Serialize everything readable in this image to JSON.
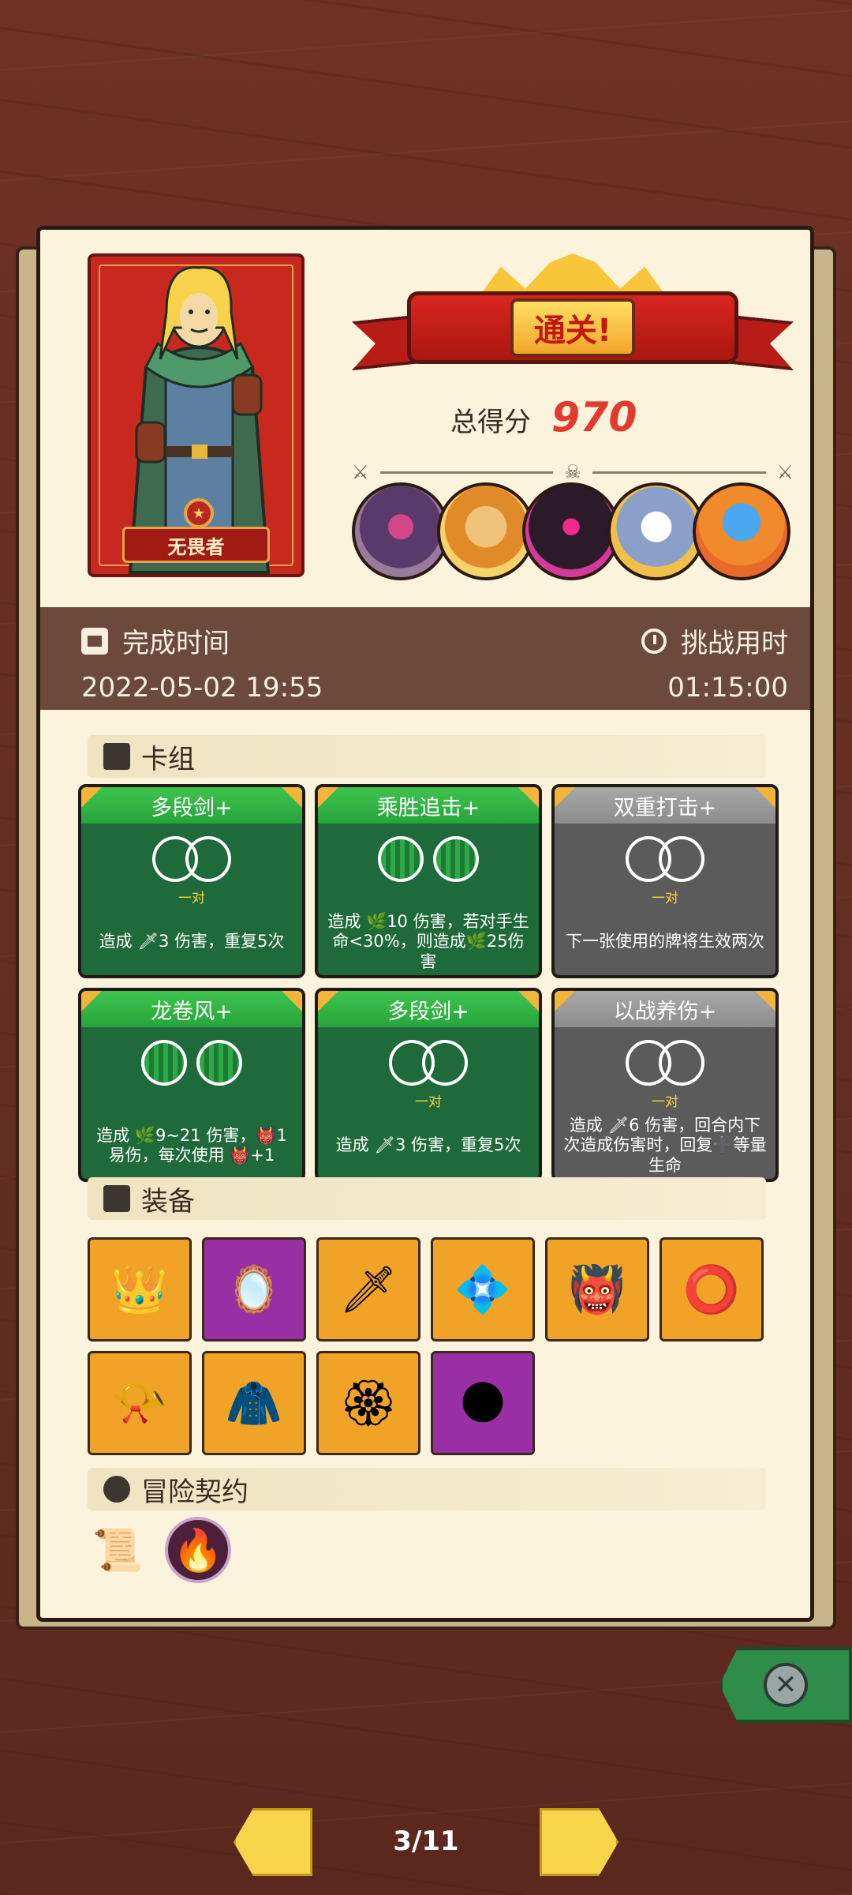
{
  "result": {
    "title": "通关!",
    "score_label": "总得分",
    "score_value": "970",
    "hero_name": "无畏者"
  },
  "info": {
    "completion_label": "完成时间",
    "completion_value": "2022-05-02 19:55",
    "duration_label": "挑战用时",
    "duration_value": "01:15:00"
  },
  "deck": {
    "title": "卡组",
    "cards": [
      {
        "name": "多段剑+",
        "style": "green",
        "orbs": "hollow",
        "pair": "一对",
        "desc": "造成 🗡3 伤害，重复5次"
      },
      {
        "name": "乘胜追击+",
        "style": "green",
        "orbs": "filled",
        "pair": "",
        "desc": "造成 🌿10 伤害，若对手生命<30%，则造成🌿25伤害"
      },
      {
        "name": "双重打击+",
        "style": "gray",
        "orbs": "hollow",
        "pair": "一对",
        "desc": "下一张使用的牌将生效两次"
      },
      {
        "name": "龙卷风+",
        "style": "green",
        "orbs": "filled",
        "pair": "",
        "desc": "造成 🌿9~21 伤害，👹1 易伤，每次使用 👹+1"
      },
      {
        "name": "多段剑+",
        "style": "green",
        "orbs": "hollow",
        "pair": "一对",
        "desc": "造成 🗡3 伤害，重复5次"
      },
      {
        "name": "以战养伤+",
        "style": "gray",
        "orbs": "hollow",
        "pair": "一对",
        "desc": "造成 🗡6 伤害，回合内下次造成伤害时，回复➕等量生命"
      }
    ]
  },
  "equipment": {
    "title": "装备",
    "items": [
      {
        "icon": "crown-icon",
        "glyph": "👑",
        "color": "orange"
      },
      {
        "icon": "mirror-icon",
        "glyph": "🪞",
        "color": "purple"
      },
      {
        "icon": "broken-blade-icon",
        "glyph": "🗡",
        "color": "orange"
      },
      {
        "icon": "blue-gem-shield-icon",
        "glyph": "💠",
        "color": "orange"
      },
      {
        "icon": "demon-skull-icon",
        "glyph": "👹",
        "color": "orange"
      },
      {
        "icon": "bracelet-icon",
        "glyph": "⭕",
        "color": "orange"
      },
      {
        "icon": "horn-icon",
        "glyph": "📯",
        "color": "orange"
      },
      {
        "icon": "sweater-icon",
        "glyph": "🧥",
        "color": "orange"
      },
      {
        "icon": "tiara-icon",
        "glyph": "🏵",
        "color": "orange"
      },
      {
        "icon": "shadow-claw-icon",
        "glyph": "🌑",
        "color": "purple"
      }
    ]
  },
  "contract": {
    "title": "冒险契约",
    "items": [
      {
        "icon": "scroll-icon",
        "glyph": "📜"
      },
      {
        "icon": "fire-book-icon",
        "glyph": "🔥"
      }
    ]
  },
  "pager": {
    "label": "3/11"
  },
  "colors": {
    "accent_red": "#e23a2c",
    "card_green": "#1f6a3a",
    "card_gray": "#5b5b5b",
    "equip_orange": "#f0a326",
    "equip_purple": "#9a2fa5"
  }
}
